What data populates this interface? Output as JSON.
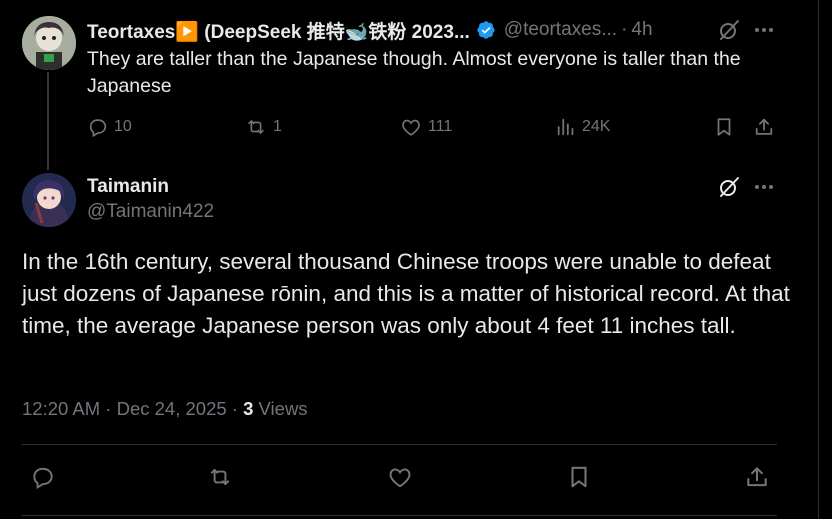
{
  "reply_tweet": {
    "display_name": "Teortaxes▶️ (DeepSeek 推特🐋铁粉 2023...",
    "handle": "@teortaxes...",
    "separator": "·",
    "time": "4h",
    "text": "They are taller than the Japanese though. Almost everyone is taller than the Japanese",
    "stats": {
      "replies": "10",
      "reposts": "1",
      "likes": "111",
      "views": "24K"
    }
  },
  "main_tweet": {
    "display_name": "Taimanin",
    "handle": "@Taimanin422",
    "text": "In the 16th century, several thousand Chinese troops were unable to defeat just dozens of Japanese rōnin, and this is a matter of historical record. At that time, the average Japanese person was only about 4 feet 11 inches tall.",
    "timestamp": "12:20 AM · Dec 24, 2025",
    "meta_separator": "·",
    "view_count": "3",
    "views_label": "Views"
  },
  "colors": {
    "background": "#000000",
    "text_primary": "#e7e9ea",
    "text_secondary": "#71767b",
    "verified_blue": "#1d9bf0",
    "divider": "#2f3336"
  },
  "icons": [
    "verified-badge-icon",
    "grok-icon",
    "more-icon",
    "reply-icon",
    "repost-icon",
    "like-icon",
    "views-icon",
    "bookmark-icon",
    "share-icon"
  ]
}
